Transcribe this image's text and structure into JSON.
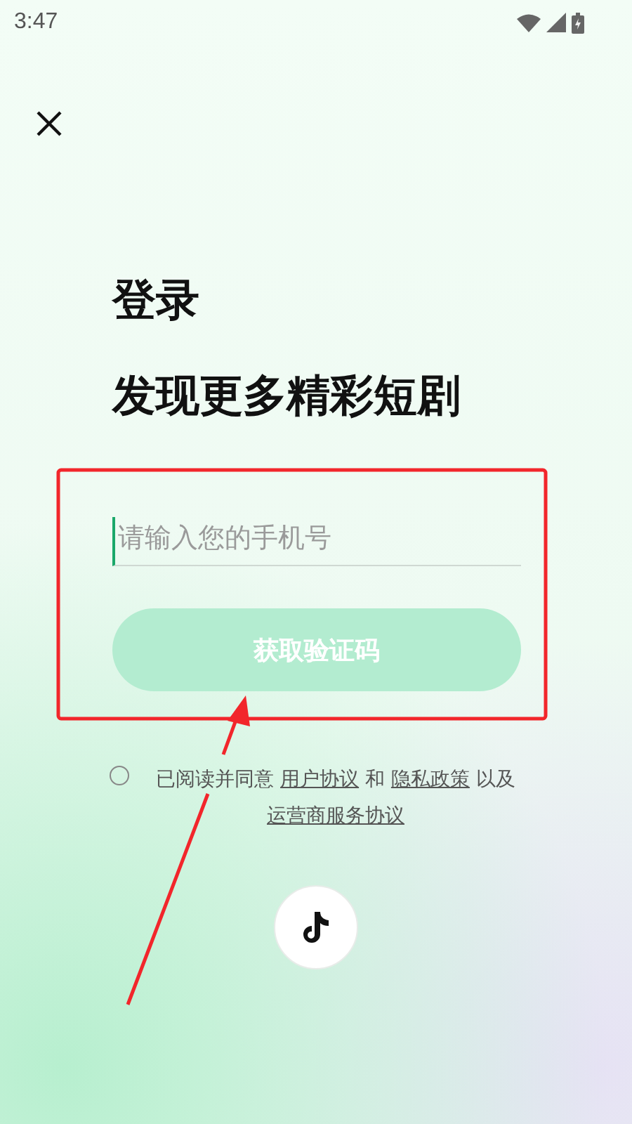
{
  "status_bar": {
    "time": "3:47"
  },
  "title": "登录",
  "subtitle": "发现更多精彩短剧",
  "phone_field": {
    "placeholder": "请输入您的手机号",
    "focused": true
  },
  "code_button": {
    "label": "获取验证码",
    "disabled": true
  },
  "agreement": {
    "checked": false,
    "parts": [
      {
        "kind": "text",
        "text": "已阅读并同意"
      },
      {
        "kind": "link",
        "text": "用户协议"
      },
      {
        "kind": "text",
        "text": "和"
      },
      {
        "kind": "link",
        "text": "隐私政策"
      },
      {
        "kind": "text",
        "text": "以及"
      },
      {
        "kind": "link",
        "text": "运营商服务协议"
      }
    ]
  }
}
